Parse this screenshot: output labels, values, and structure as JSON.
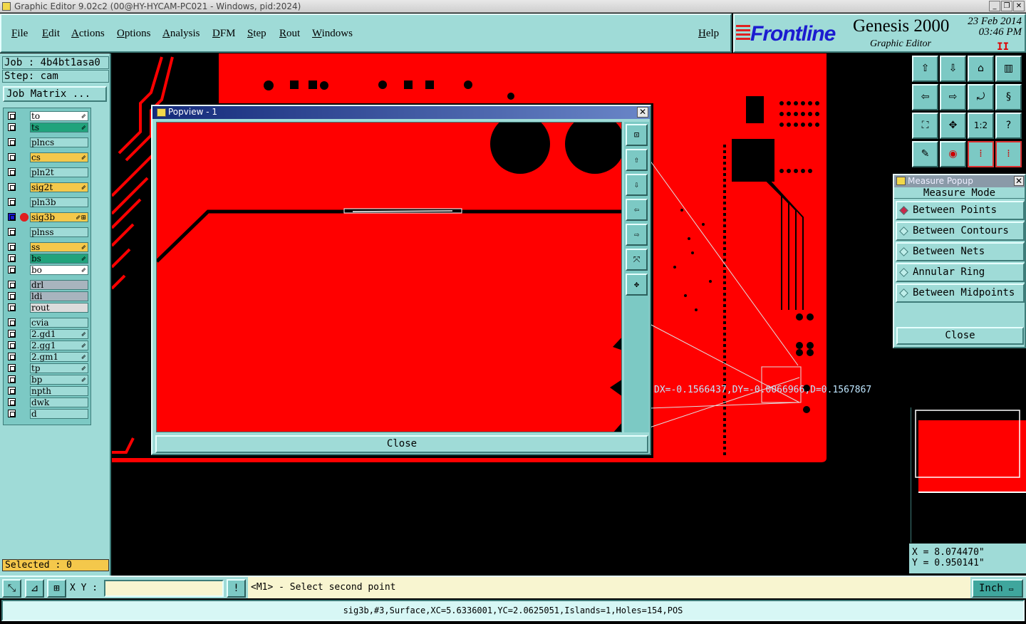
{
  "window": {
    "title": "Graphic Editor 9.02c2 (00@HY-HYCAM-PC021 - Windows, pid:2024)",
    "min": "_",
    "max": "❐",
    "close": "✕"
  },
  "menu": {
    "items": [
      "File",
      "Edit",
      "Actions",
      "Options",
      "Analysis",
      "DFM",
      "Step",
      "Rout",
      "Windows"
    ],
    "help": "Help"
  },
  "brand": {
    "logo": "Frontline",
    "product": "Genesis 2000",
    "subtitle": "Graphic Editor",
    "date": "23 Feb 2014",
    "time": "03:46 PM",
    "pause": "II"
  },
  "job": {
    "job_line": "Job : 4b4bt1asa0",
    "step_line": "Step: cam",
    "matrix_button": "Job Matrix ..."
  },
  "layers": [
    {
      "name": "to",
      "color": "#ffffff",
      "flag": "⇙"
    },
    {
      "name": "ts",
      "color": "#21a37c",
      "flag": "⇙"
    },
    {
      "name": "plncs",
      "color": "#9fdbd7",
      "flag": ""
    },
    {
      "name": "cs",
      "color": "#f4c84b",
      "flag": "⇙"
    },
    {
      "name": "pln2t",
      "color": "#9fdbd7",
      "flag": ""
    },
    {
      "name": "sig2t",
      "color": "#f4c84b",
      "flag": "⇙"
    },
    {
      "name": "pln3b",
      "color": "#9fdbd7",
      "flag": ""
    },
    {
      "name": "sig3b",
      "color": "#f4c84b",
      "flag": "⇙⊞",
      "active": true
    },
    {
      "name": "plnss",
      "color": "#9fdbd7",
      "flag": ""
    },
    {
      "name": "ss",
      "color": "#f4c84b",
      "flag": "⇙"
    },
    {
      "name": "bs",
      "color": "#21a37c",
      "flag": "⇙"
    },
    {
      "name": "bo",
      "color": "#ffffff",
      "flag": "⇙"
    },
    {
      "name": "drl",
      "color": "#a8b4be",
      "flag": ""
    },
    {
      "name": "ldi",
      "color": "#a8b4be",
      "flag": ""
    },
    {
      "name": "rout",
      "color": "#dcdcdc",
      "flag": ""
    },
    {
      "name": "cvia",
      "color": "#9fdbd7",
      "flag": ""
    },
    {
      "name": "2.gd1",
      "color": "#9fdbd7",
      "flag": "⇙"
    },
    {
      "name": "2.gg1",
      "color": "#9fdbd7",
      "flag": "⇙"
    },
    {
      "name": "2.gm1",
      "color": "#9fdbd7",
      "flag": "⇙"
    },
    {
      "name": "tp",
      "color": "#9fdbd7",
      "flag": "⇙"
    },
    {
      "name": "bp",
      "color": "#9fdbd7",
      "flag": "⇙"
    },
    {
      "name": "npth",
      "color": "#9fdbd7",
      "flag": ""
    },
    {
      "name": "dwk",
      "color": "#9fdbd7",
      "flag": ""
    },
    {
      "name": "d",
      "color": "#9fdbd7",
      "flag": ""
    }
  ],
  "selected": "Selected : 0",
  "toolbox": [
    "⇧",
    "⇩",
    "⌂",
    "▥",
    "⇦",
    "⇨",
    "⤾",
    "§",
    "⛶",
    "✥",
    "1:2",
    "?",
    "✎",
    "◉",
    "⁞",
    "⁞"
  ],
  "popview": {
    "title": "Popview - 1",
    "close": "Close",
    "tools": [
      "⊡",
      "⇧",
      "⇩",
      "⇦",
      "⇨",
      "⤧",
      "✥"
    ]
  },
  "measure": {
    "title": "Measure Popup",
    "mode_label": "Measure Mode",
    "options": [
      "Between Points",
      "Between Contours",
      "Between Nets",
      "Annular Ring",
      "Between Midpoints"
    ],
    "selected_index": 0,
    "close": "Close"
  },
  "measurement_text": "DX=-0.1566437,DY=-0.0066966,D=0.1567867",
  "coords": {
    "x": "X = 8.074470\"",
    "y": "Y = 0.950141\""
  },
  "command": {
    "xy_label": "X Y :",
    "xy_value": "",
    "prompt": "<M1> - Select second point",
    "unit": "Inch",
    "bang": "!"
  },
  "status": "sig3b,#3,Surface,XC=5.6336001,YC=2.0625051,Islands=1,Holes=154,POS"
}
